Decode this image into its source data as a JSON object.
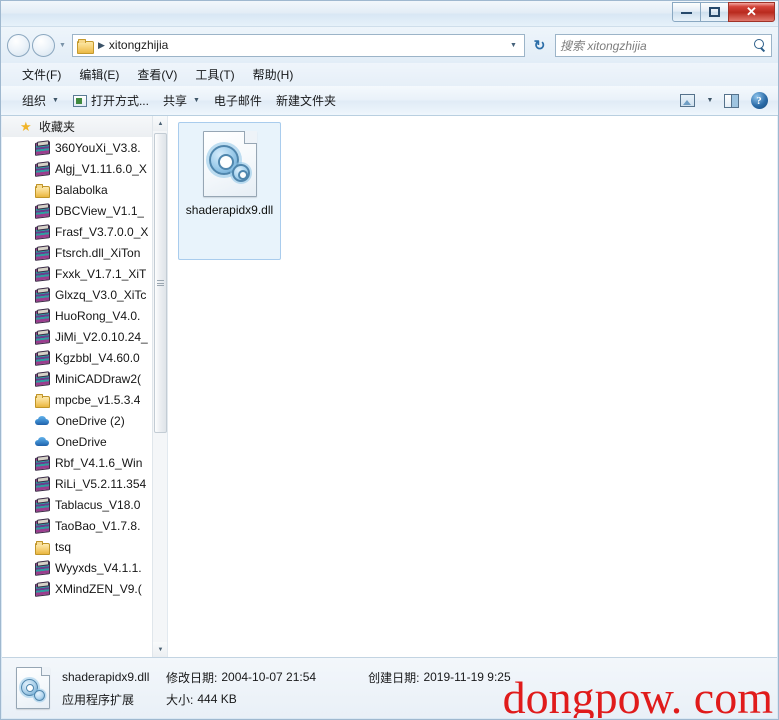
{
  "window": {
    "minimize_label": "Minimize",
    "maximize_label": "Maximize",
    "close_label": "✕"
  },
  "address": {
    "back_label": "",
    "forward_label": "",
    "history_caret": "▼",
    "folder_icon": "folder-icon",
    "separator": "▶",
    "path": "xitongzhijia",
    "dropdown_caret": "▼",
    "refresh_glyph": "↻"
  },
  "search": {
    "placeholder": "搜索 xitongzhijia",
    "icon": "search-icon"
  },
  "menubar": {
    "items": [
      {
        "label": "文件(F)"
      },
      {
        "label": "编辑(E)"
      },
      {
        "label": "查看(V)"
      },
      {
        "label": "工具(T)"
      },
      {
        "label": "帮助(H)"
      }
    ]
  },
  "toolbar": {
    "organize_label": "组织",
    "organize_caret": "▼",
    "openwith_label": "打开方式...",
    "share_label": "共享",
    "share_caret": "▼",
    "email_label": "电子邮件",
    "newfolder_label": "新建文件夹",
    "view_caret": "▼",
    "view_icon": "view-options-icon",
    "preview_icon": "preview-pane-icon",
    "help_icon": "help-icon",
    "help_glyph": "?"
  },
  "sidebar": {
    "header": {
      "label": "收藏夹",
      "icon": "star-icon"
    },
    "items": [
      {
        "label": "360YouXi_V3.8.",
        "icon": "archive-icon"
      },
      {
        "label": "Algj_V1.11.6.0_X",
        "icon": "archive-icon"
      },
      {
        "label": "Balabolka",
        "icon": "folder-icon"
      },
      {
        "label": "DBCView_V1.1_",
        "icon": "archive-icon"
      },
      {
        "label": "Frasf_V3.7.0.0_X",
        "icon": "archive-icon"
      },
      {
        "label": "Ftsrch.dll_XiTon",
        "icon": "archive-icon"
      },
      {
        "label": "Fxxk_V1.7.1_XiT",
        "icon": "archive-icon"
      },
      {
        "label": "Glxzq_V3.0_XiTc",
        "icon": "archive-icon"
      },
      {
        "label": "HuoRong_V4.0.",
        "icon": "archive-icon"
      },
      {
        "label": "JiMi_V2.0.10.24_",
        "icon": "archive-icon"
      },
      {
        "label": "Kgzbbl_V4.60.0",
        "icon": "archive-icon"
      },
      {
        "label": "MiniCADDraw2(",
        "icon": "archive-icon"
      },
      {
        "label": "mpcbe_v1.5.3.4",
        "icon": "folder-icon"
      },
      {
        "label": "OneDrive (2)",
        "icon": "cloud-icon"
      },
      {
        "label": "OneDrive",
        "icon": "cloud-icon"
      },
      {
        "label": "Rbf_V4.1.6_Win",
        "icon": "archive-icon"
      },
      {
        "label": "RiLi_V5.2.11.354",
        "icon": "archive-icon"
      },
      {
        "label": "Tablacus_V18.0",
        "icon": "archive-icon"
      },
      {
        "label": "TaoBao_V1.7.8.",
        "icon": "archive-icon"
      },
      {
        "label": "tsq",
        "icon": "folder-icon"
      },
      {
        "label": "Wyyxds_V4.1.1.",
        "icon": "archive-icon"
      },
      {
        "label": "XMindZEN_V9.(",
        "icon": "archive-icon"
      }
    ],
    "scroll_up": "▲",
    "scroll_down": "▼"
  },
  "content": {
    "files": [
      {
        "name": "shaderapidx9.dll",
        "icon": "dll-file-icon",
        "selected": true
      }
    ]
  },
  "statusbar": {
    "file_name": "shaderapidx9.dll",
    "file_type": "应用程序扩展",
    "modified_label": "修改日期:",
    "modified_value": "2004-10-07 21:54",
    "created_label": "创建日期:",
    "created_value": "2019-11-19 9:25",
    "size_label": "大小:",
    "size_value": "444 KB",
    "icon": "dll-file-icon"
  },
  "watermark": {
    "text": "dongpow. com",
    "color": "#e01b1b"
  }
}
